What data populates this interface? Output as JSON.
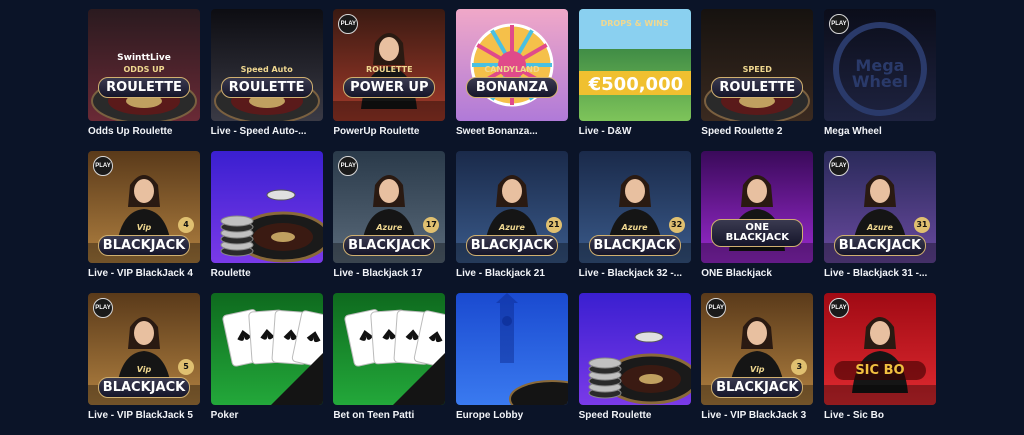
{
  "games": [
    {
      "title": "Odds Up Roulette",
      "thumb_text": "ROULETTE",
      "thumb_sub": "ODDS UP",
      "thumb_brand": "SwinttLive",
      "palette": [
        "#2a1a1f",
        "#6a2a36"
      ],
      "icon": "roulette-wheel-icon"
    },
    {
      "title": "Live - Speed Auto-...",
      "thumb_text": "ROULETTE",
      "thumb_sub": "Speed Auto",
      "palette": [
        "#0d0d12",
        "#3a3a45"
      ],
      "icon": "roulette-wheel-icon"
    },
    {
      "title": "PowerUp Roulette",
      "thumb_text": "POWER UP",
      "thumb_sub": "ROULETTE",
      "palette": [
        "#3a1a12",
        "#a33a2a"
      ],
      "icon": "dealer-icon",
      "badge": "PLAY"
    },
    {
      "title": "Sweet Bonanza...",
      "thumb_text": "BONANZA",
      "thumb_sub": "CANDYLAND",
      "palette": [
        "#f0a8c8",
        "#b07ad8"
      ],
      "icon": "candy-wheel-icon"
    },
    {
      "title": "Live - D&W",
      "thumb_text": "€500,000",
      "thumb_sub": "DROPS & WINS",
      "palette": [
        "#1e6e3a",
        "#7ec45a"
      ],
      "icon": "casino-banner-icon"
    },
    {
      "title": "Speed Roulette 2",
      "thumb_text": "ROULETTE",
      "thumb_sub": "SPEED",
      "palette": [
        "#16120f",
        "#3a2a20"
      ],
      "icon": "roulette-wheel-icon"
    },
    {
      "title": "Mega Wheel",
      "thumb_text": "Mega Wheel",
      "thumb_sub": "",
      "palette": [
        "#0b0d1a",
        "#1e2340"
      ],
      "icon": "mega-wheel-icon",
      "badge": "PLAY"
    },
    {
      "title": "Live - VIP BlackJack 4",
      "thumb_text": "BLACKJACK",
      "thumb_sub": "Vip",
      "thumb_num": "4",
      "palette": [
        "#5a3a1a",
        "#b08040"
      ],
      "icon": "dealer-icon",
      "badge": "PLAY"
    },
    {
      "title": "Roulette",
      "thumb_text": "",
      "thumb_sub": "",
      "palette": [
        "#3a1fd0",
        "#7a3ae8"
      ],
      "icon": "roulette-chips-icon"
    },
    {
      "title": "Live - Blackjack 17",
      "thumb_text": "BLACKJACK",
      "thumb_sub": "Azure",
      "thumb_num": "17",
      "palette": [
        "#2a3a4a",
        "#5a6a7a"
      ],
      "icon": "dealer-icon",
      "badge": "PLAY"
    },
    {
      "title": "Live - Blackjack 21",
      "thumb_text": "BLACKJACK",
      "thumb_sub": "Azure",
      "thumb_num": "21",
      "palette": [
        "#1a2a4a",
        "#3a5a8a"
      ],
      "icon": "dealer-icon"
    },
    {
      "title": "Live - Blackjack 32 -...",
      "thumb_text": "BLACKJACK",
      "thumb_sub": "Azure",
      "thumb_num": "32",
      "palette": [
        "#1a2a4a",
        "#3a5a8a"
      ],
      "icon": "dealer-icon"
    },
    {
      "title": "ONE Blackjack",
      "thumb_text": "ONE BLACKJACK",
      "thumb_sub": "",
      "palette": [
        "#3a0a5a",
        "#9a2ad0"
      ],
      "icon": "dealer-icon"
    },
    {
      "title": "Live - Blackjack 31 -...",
      "thumb_text": "BLACKJACK",
      "thumb_sub": "Azure",
      "thumb_num": "31",
      "palette": [
        "#2a2a5a",
        "#6a4aa0"
      ],
      "icon": "dealer-icon",
      "badge": "PLAY"
    },
    {
      "title": "Live - VIP BlackJack 5",
      "thumb_text": "BLACKJACK",
      "thumb_sub": "Vip",
      "thumb_num": "5",
      "palette": [
        "#5a3a1a",
        "#b08040"
      ],
      "icon": "dealer-icon",
      "badge": "PLAY"
    },
    {
      "title": "Poker",
      "thumb_text": "",
      "thumb_sub": "",
      "palette": [
        "#0e6a1e",
        "#23a83a"
      ],
      "icon": "playing-cards-icon"
    },
    {
      "title": "Bet on Teen Patti",
      "thumb_text": "",
      "thumb_sub": "",
      "palette": [
        "#0e6a1e",
        "#23a83a"
      ],
      "icon": "playing-cards-icon"
    },
    {
      "title": "Europe Lobby",
      "thumb_text": "",
      "thumb_sub": "",
      "palette": [
        "#1a4ad0",
        "#3a7af0"
      ],
      "icon": "europe-lobby-icon"
    },
    {
      "title": "Speed Roulette",
      "thumb_text": "",
      "thumb_sub": "",
      "palette": [
        "#3a1fd0",
        "#7a3ae8"
      ],
      "icon": "roulette-chips-icon"
    },
    {
      "title": "Live - VIP BlackJack 3",
      "thumb_text": "BLACKJACK",
      "thumb_sub": "Vip",
      "thumb_num": "3",
      "palette": [
        "#5a3a1a",
        "#b08040"
      ],
      "icon": "dealer-icon",
      "badge": "PLAY"
    },
    {
      "title": "Live - Sic Bo",
      "thumb_text": "SIC BO",
      "thumb_sub": "",
      "palette": [
        "#a00a14",
        "#e02a30"
      ],
      "icon": "dealer-icon",
      "badge": "PLAY"
    }
  ],
  "colors": {
    "background": "#0b1428",
    "title_text": "#f2f4f8"
  }
}
